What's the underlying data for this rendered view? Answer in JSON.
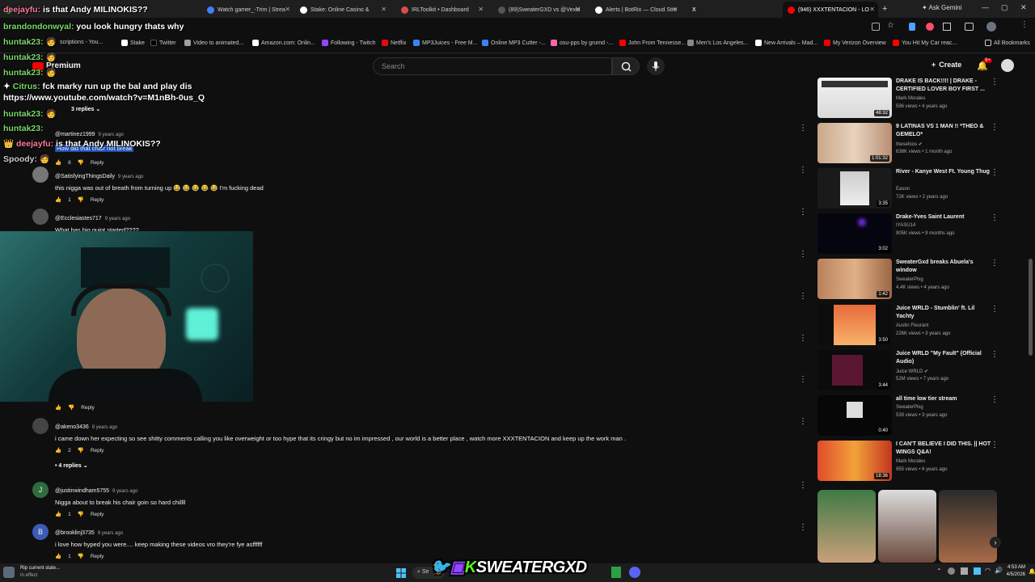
{
  "tabs": [
    {
      "label": "",
      "color": "#2ea043",
      "x": 0,
      "w": 125
    },
    {
      "label": "Watch gamer_-Trim | Strea",
      "color": "#3b82f6"
    },
    {
      "label": "Stake: Online Casino &",
      "color": "#ffffff"
    },
    {
      "label": "IRLToolkit • Dashboard",
      "color": "#d94c4c"
    },
    {
      "label": "(89)SweaterGXD vs @Vexbi",
      "color": "#111111"
    },
    {
      "label": "Alerts | BotRix — Cloud Stre",
      "color": "#ffffff"
    },
    {
      "label": "X",
      "color": "#000000"
    },
    {
      "label": "(946) XXXTENTACION - LO",
      "color": "#ff0000"
    }
  ],
  "ask_gemini": "Ask Gemini",
  "bookmarks": [
    {
      "label": "scriptions - You...",
      "color": "#ff0000"
    },
    {
      "label": "Stake",
      "color": "#ffffff"
    },
    {
      "label": "Twitter",
      "color": "#000000"
    },
    {
      "label": "Video to animated...",
      "color": "#9aa0a6"
    },
    {
      "label": "Amazon.com: Onlin...",
      "color": "#ffffff"
    },
    {
      "label": "Following - Twitch",
      "color": "#9146ff"
    },
    {
      "label": "Netflix",
      "color": "#e50914"
    },
    {
      "label": "MP3Juices - Free M...",
      "color": "#3b82f6"
    },
    {
      "label": "Online MP3 Cutter -...",
      "color": "#3b82f6"
    },
    {
      "label": "osu-pps by grumd -...",
      "color": "#ff66aa"
    },
    {
      "label": "John From Tennesse...",
      "color": "#ff0000"
    },
    {
      "label": "Men's Los Angeles...",
      "color": "#888888"
    },
    {
      "label": "New Arrivals – Mad...",
      "color": "#ffffff"
    },
    {
      "label": "My Verizon Overview",
      "color": "#e00"
    },
    {
      "label": "You Hit My Car reac...",
      "color": "#ff0000"
    },
    {
      "label": "All Bookmarks",
      "color": "#cccccc"
    }
  ],
  "youtube": {
    "logo": "Premium",
    "search_placeholder": "Search",
    "create_label": "Create",
    "notif_count": "9+"
  },
  "chat": [
    {
      "user": "deejayfu:",
      "msg": "is that Andy MILINOKIS??",
      "color": "#ff7b9c"
    },
    {
      "user": "brandondonwyal:",
      "msg": "you look hungry thats why",
      "color": "#7bd96b"
    },
    {
      "user": "huntak23:",
      "msg": "",
      "color": "#7bd96b"
    },
    {
      "user": "huntak23:",
      "msg": "",
      "color": "#7bd96b"
    },
    {
      "user": "huntak23:",
      "msg": "",
      "color": "#7bd96b"
    },
    {
      "user": "Citrus:",
      "msg": "fck marky run up the bal and play dis",
      "color": "#7bd96b"
    },
    {
      "user": "",
      "msg": "https://www.youtube.com/watch?v=M1nBh-0us_Q",
      "color": "#ffffff"
    },
    {
      "user": "huntak23:",
      "msg": "",
      "color": "#7bd96b"
    },
    {
      "user": "huntak23:",
      "msg": "",
      "color": "#7bd96b"
    },
    {
      "user": "deejayfu:",
      "msg": "is that Andy MILINOKIS??",
      "color": "#ff7b9c"
    },
    {
      "user": "Spoody:",
      "msg": "",
      "color": "#cccccc"
    }
  ],
  "comments": [
    {
      "user": "@martinez1999",
      "age": "9 years ago",
      "text": "How did that chair not break",
      "likes": "8",
      "reply": "Reply",
      "replies": "3 replies"
    },
    {
      "user": "@SatisfyingThingsDaily",
      "age": "9 years ago",
      "text": "this nigga was out of breath from turning up 😂 😂 😂 😂 😂  I'm fucking dead",
      "likes": "1",
      "reply": "Reply"
    },
    {
      "user": "@Ecclesiastes717",
      "age": "9 years ago",
      "text": "What has big quint started????",
      "likes": "",
      "reply": "Reply"
    },
    {
      "user": "@akeno3436",
      "age": "9 years ago",
      "text": "i came down her expecting so see shitty comments calling you like overweight or too hype that its cringy but no im impressed , our world is a better place , watch more XXXTENTACION and keep up the work man .",
      "likes": "2",
      "reply": "Reply",
      "replies": "4 replies"
    },
    {
      "user": "@justinwindham5755",
      "age": "9 years ago",
      "text": "Nigga about to break his chair goin so hard chillll",
      "likes": "1",
      "reply": "Reply",
      "avatar_letter": "J"
    },
    {
      "user": "@brooklinj3735",
      "age": "9 years ago",
      "text": "i love how hyped you were.... keep making these videos vro they're fye asffffff",
      "likes": "1",
      "reply": "Reply",
      "avatar_letter": "B"
    }
  ],
  "sidebar": [
    {
      "title": "DRAKE IS BACK!!!! | DRAKE - CERTIFIED LOVER BOY FIRST ...",
      "channel": "Mark Morales",
      "meta": "596 views • 4 years ago",
      "dur": "48:32"
    },
    {
      "title": "9 LATINAS VS 1 MAN !! *THEO & GEMELO*",
      "channel": "thesefoos",
      "meta": "638K views • 1 month ago",
      "dur": "1:01:32"
    },
    {
      "title": "River - Kanye West Ft. Young Thug",
      "channel": "Eason",
      "meta": "72K views • 2 years ago",
      "dur": "3:35"
    },
    {
      "title": "Drake-Yves Saint Laurent",
      "channel": "IYASU14",
      "meta": "905K views • 9 months ago",
      "dur": "3:02"
    },
    {
      "title": "SweaterGxd breaks Abuela's window",
      "channel": "SweaterPlxg",
      "meta": "4.4K views • 4 years ago",
      "dur": "1:42"
    },
    {
      "title": "Juice WRLD - Stumblin' ft. Lil Yachty",
      "channel": "Austin Fleurant",
      "meta": "226K views • 3 years ago",
      "dur": "3:50"
    },
    {
      "title": "Juice WRLD \"My Fault\" (Official Audio)",
      "channel": "Juice WRLD",
      "meta": "52M views • 7 years ago",
      "dur": "3:44"
    },
    {
      "title": "all time low tier stream",
      "channel": "SweaterPlxg",
      "meta": "539 views • 3 years ago",
      "dur": "0:40"
    },
    {
      "title": "I CAN'T BELIEVE I DID THIS. || HOT WINGS Q&A!",
      "channel": "Mark Morales",
      "meta": "955 views • 6 years ago",
      "dur": "18:36"
    }
  ],
  "banner": "SWEATERGXD",
  "taskbar": {
    "weather_line1": "Rip current state...",
    "weather_line2": "In effect",
    "time": "4:53 AM",
    "date": "4/5/2026",
    "search": "Se"
  }
}
